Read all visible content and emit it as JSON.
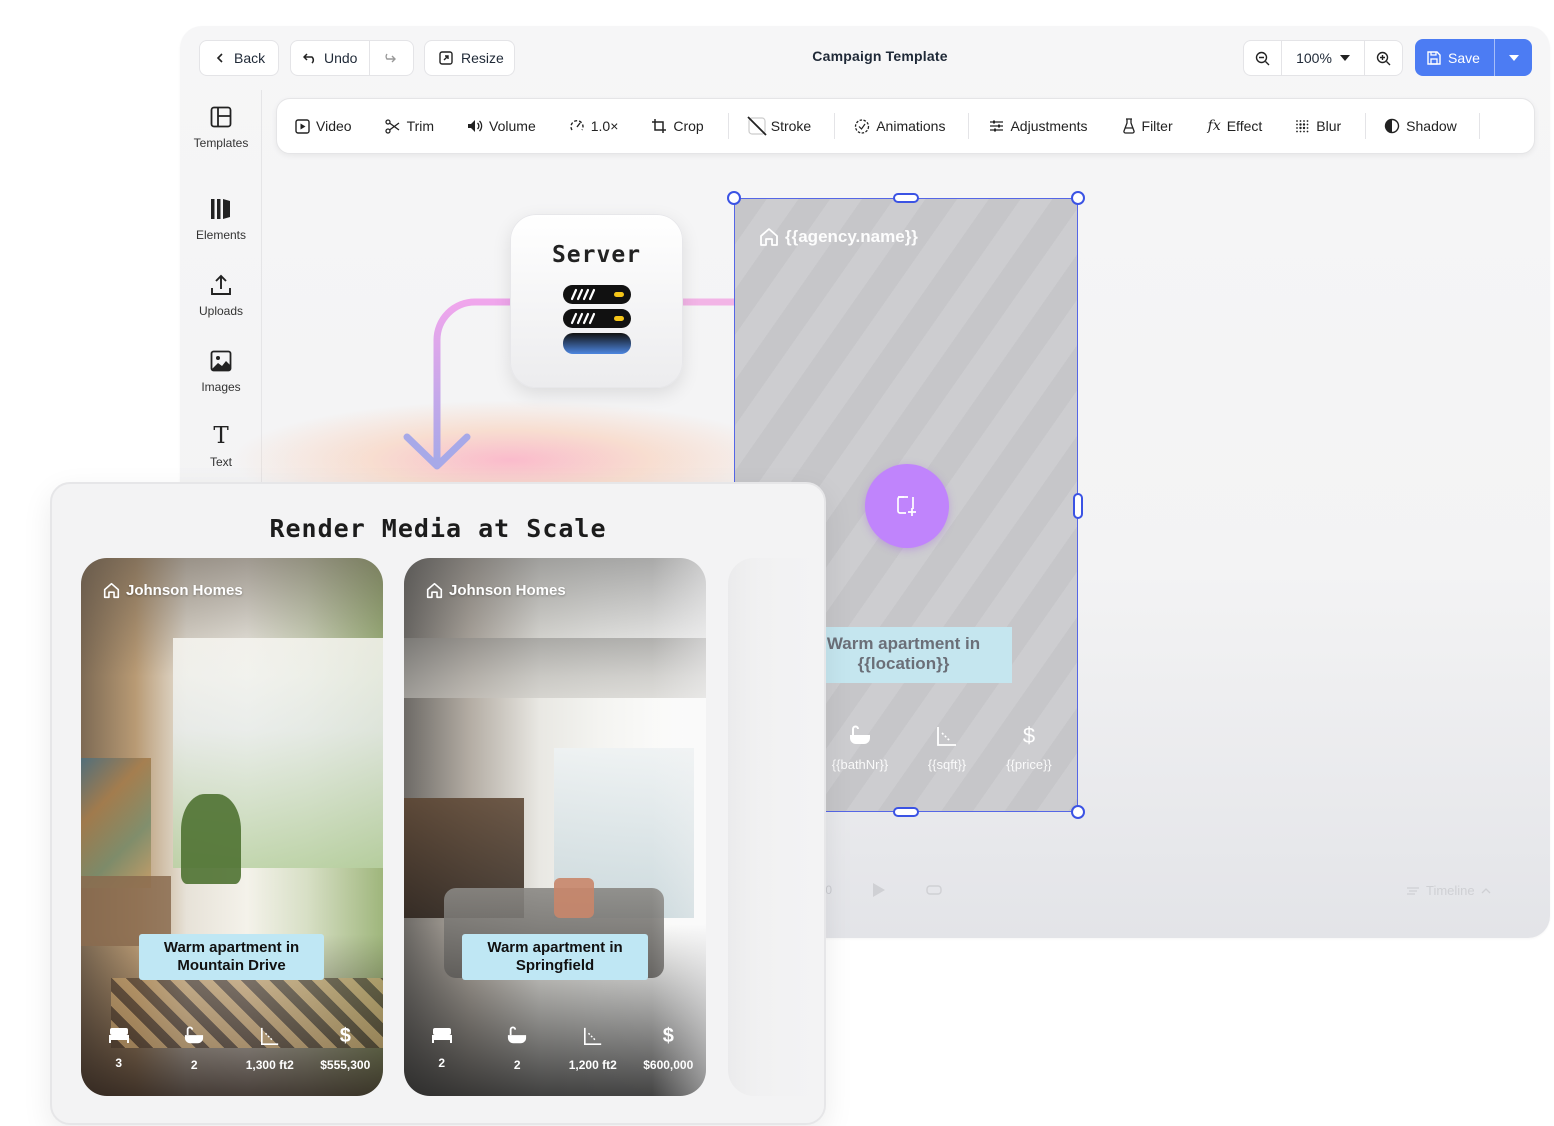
{
  "topbar": {
    "back_label": "Back",
    "undo_label": "Undo",
    "resize_label": "Resize",
    "title": "Campaign Template",
    "zoom_value": "100%",
    "save_label": "Save"
  },
  "sidebar": {
    "items": [
      {
        "label": "Templates",
        "icon": "templates-icon"
      },
      {
        "label": "Elements",
        "icon": "elements-icon"
      },
      {
        "label": "Uploads",
        "icon": "upload-icon"
      },
      {
        "label": "Images",
        "icon": "image-icon"
      },
      {
        "label": "Text",
        "icon": "text-icon"
      }
    ]
  },
  "toolbar": {
    "video": "Video",
    "trim": "Trim",
    "volume": "Volume",
    "speed": "1.0×",
    "crop": "Crop",
    "stroke": "Stroke",
    "animations": "Animations",
    "adjustments": "Adjustments",
    "filter": "Filter",
    "effect": "Effect",
    "blur": "Blur",
    "shadow": "Shadow"
  },
  "server": {
    "label": "Server"
  },
  "template_frame": {
    "agency": "{{agency.name}}",
    "caption_line1": "Warm apartment in",
    "caption_line2": "{{location}}",
    "stats": [
      "{{bathNr}}",
      "{{sqft}}",
      "{{price}}"
    ]
  },
  "playback": {
    "time": "/ 0:20",
    "timeline_label": "Timeline"
  },
  "render_panel": {
    "title": "Render Media at Scale",
    "cards": [
      {
        "brand": "Johnson Homes",
        "caption_line1": "Warm apartment in",
        "caption_line2": "Mountain Drive",
        "beds": "3",
        "baths": "2",
        "sqft": "1,300 ft2",
        "price": "$555,300"
      },
      {
        "brand": "Johnson Homes",
        "caption_line1": "Warm apartment in",
        "caption_line2": "Springfield",
        "beds": "2",
        "baths": "2",
        "sqft": "1,200 ft2",
        "price": "$600,000"
      }
    ]
  },
  "colors": {
    "accent": "#4c7cf3",
    "selection": "#3b53e4",
    "add_button": "#c084fc",
    "caption_bg": "#bfe7f4"
  }
}
